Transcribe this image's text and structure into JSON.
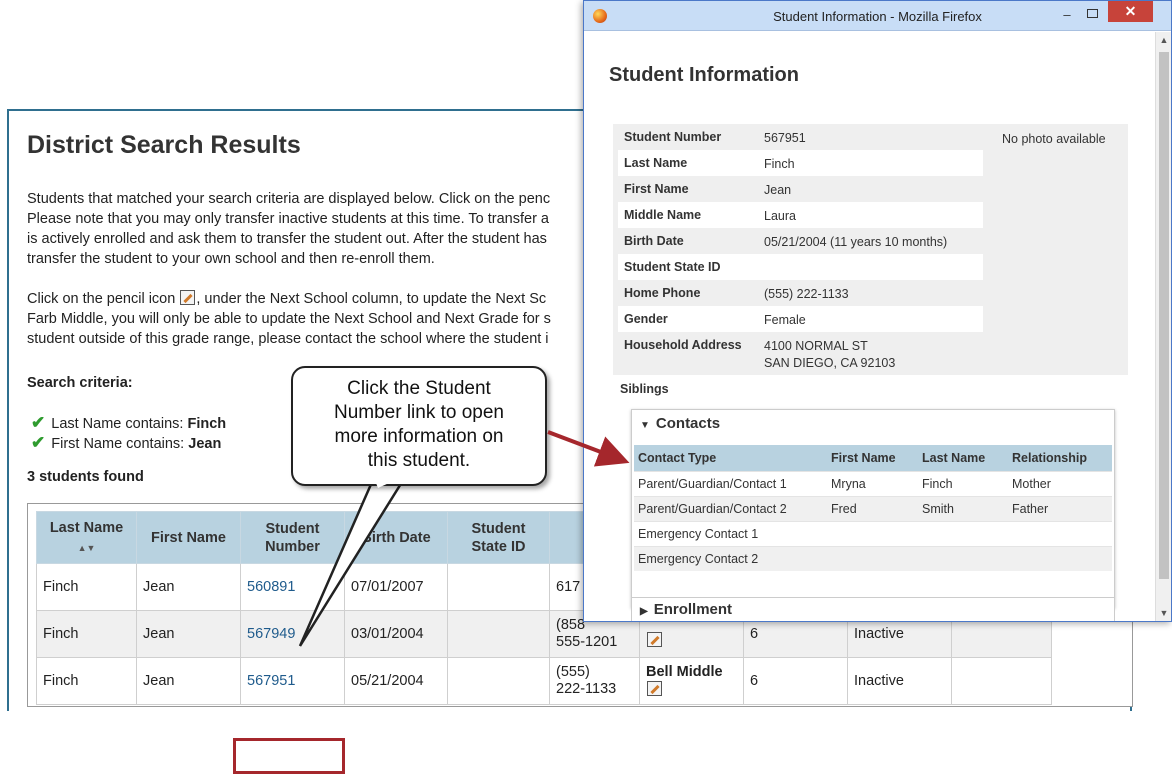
{
  "page": {
    "title": "District Search Results",
    "intro_lines": [
      "Students that matched your search criteria are displayed below. Click on the penc",
      "Please note that you may only transfer inactive students at this time. To transfer a",
      "is actively enrolled and ask them to transfer the student out. After the student has",
      "transfer the student to your own school and then re-enroll them."
    ],
    "pencil_line_1a": "Click on the pencil icon",
    "pencil_line_1b": ", under the Next School column, to update the Next Sc",
    "pencil_lines": [
      "Farb Middle, you will only be able to update the Next School and Next Grade for s",
      "student outside of this grade range, please contact the school where the student i"
    ],
    "criteria_label": "Search criteria:",
    "criteria": [
      {
        "label": "Last Name contains: ",
        "value": "Finch"
      },
      {
        "label": "First Name contains: ",
        "value": "Jean"
      }
    ],
    "found_text": "3 students found"
  },
  "results_table": {
    "headers": {
      "last_name": "Last Name",
      "sort_icon": "sort-icon",
      "first_name": "First Name",
      "student_number_1": "Student",
      "student_number_2": "Number",
      "birth_date": "Birth Date",
      "state_id_1": "Student",
      "state_id_2": "State ID"
    },
    "rows": [
      {
        "last": "Finch",
        "first": "Jean",
        "number": "560891",
        "birth": "07/01/2007",
        "phone1": "617",
        "phone2": "",
        "school": "",
        "grade": "",
        "status": ""
      },
      {
        "last": "Finch",
        "first": "Jean",
        "number": "567949",
        "birth": "03/01/2004",
        "phone1": "(858",
        "phone2": "555-1201",
        "school": "",
        "grade": "6",
        "status": "Inactive"
      },
      {
        "last": "Finch",
        "first": "Jean",
        "number": "567951",
        "birth": "05/21/2004",
        "phone1": "(555)",
        "phone2": "222-1133",
        "school": "Bell Middle",
        "grade": "6",
        "status": "Inactive"
      }
    ]
  },
  "callout": {
    "lines": [
      "Click the Student",
      "Number link to open",
      "more information on",
      "this student."
    ]
  },
  "popup": {
    "window_title": "Student Information - Mozilla Firefox",
    "minimize": "–",
    "close": "✕",
    "heading": "Student Information",
    "no_photo": "No photo available",
    "fields": [
      {
        "key": "Student Number",
        "value": "567951"
      },
      {
        "key": "Last Name",
        "value": "Finch"
      },
      {
        "key": "First Name",
        "value": "Jean"
      },
      {
        "key": "Middle Name",
        "value": "Laura"
      },
      {
        "key": "Birth Date",
        "value": "05/21/2004 (11 years 10 months)"
      },
      {
        "key": "Student State ID",
        "value": ""
      },
      {
        "key": "Home Phone",
        "value": "(555) 222-1133"
      },
      {
        "key": "Gender",
        "value": "Female"
      },
      {
        "key": "Household Address",
        "value": "4100 NORMAL ST",
        "value2": "SAN DIEGO, CA 92103"
      }
    ],
    "siblings_label": "Siblings",
    "contacts": {
      "title": "Contacts",
      "headers": [
        "Contact Type",
        "First Name",
        "Last Name",
        "Relationship"
      ],
      "rows": [
        [
          "Parent/Guardian/Contact 1",
          "Mryna",
          "Finch",
          "Mother"
        ],
        [
          "Parent/Guardian/Contact 2",
          "Fred",
          "Smith",
          "Father"
        ],
        [
          "Emergency Contact 1",
          "",
          "",
          ""
        ],
        [
          "Emergency Contact 2",
          "",
          "",
          ""
        ]
      ]
    },
    "enrollment_title": "Enrollment"
  },
  "colors": {
    "header_blue": "#b8d2e0",
    "link_blue": "#1f5b8c",
    "highlight_red": "#a5272c",
    "titlebar_blue": "#c8ddf6",
    "close_red": "#c7433a"
  }
}
